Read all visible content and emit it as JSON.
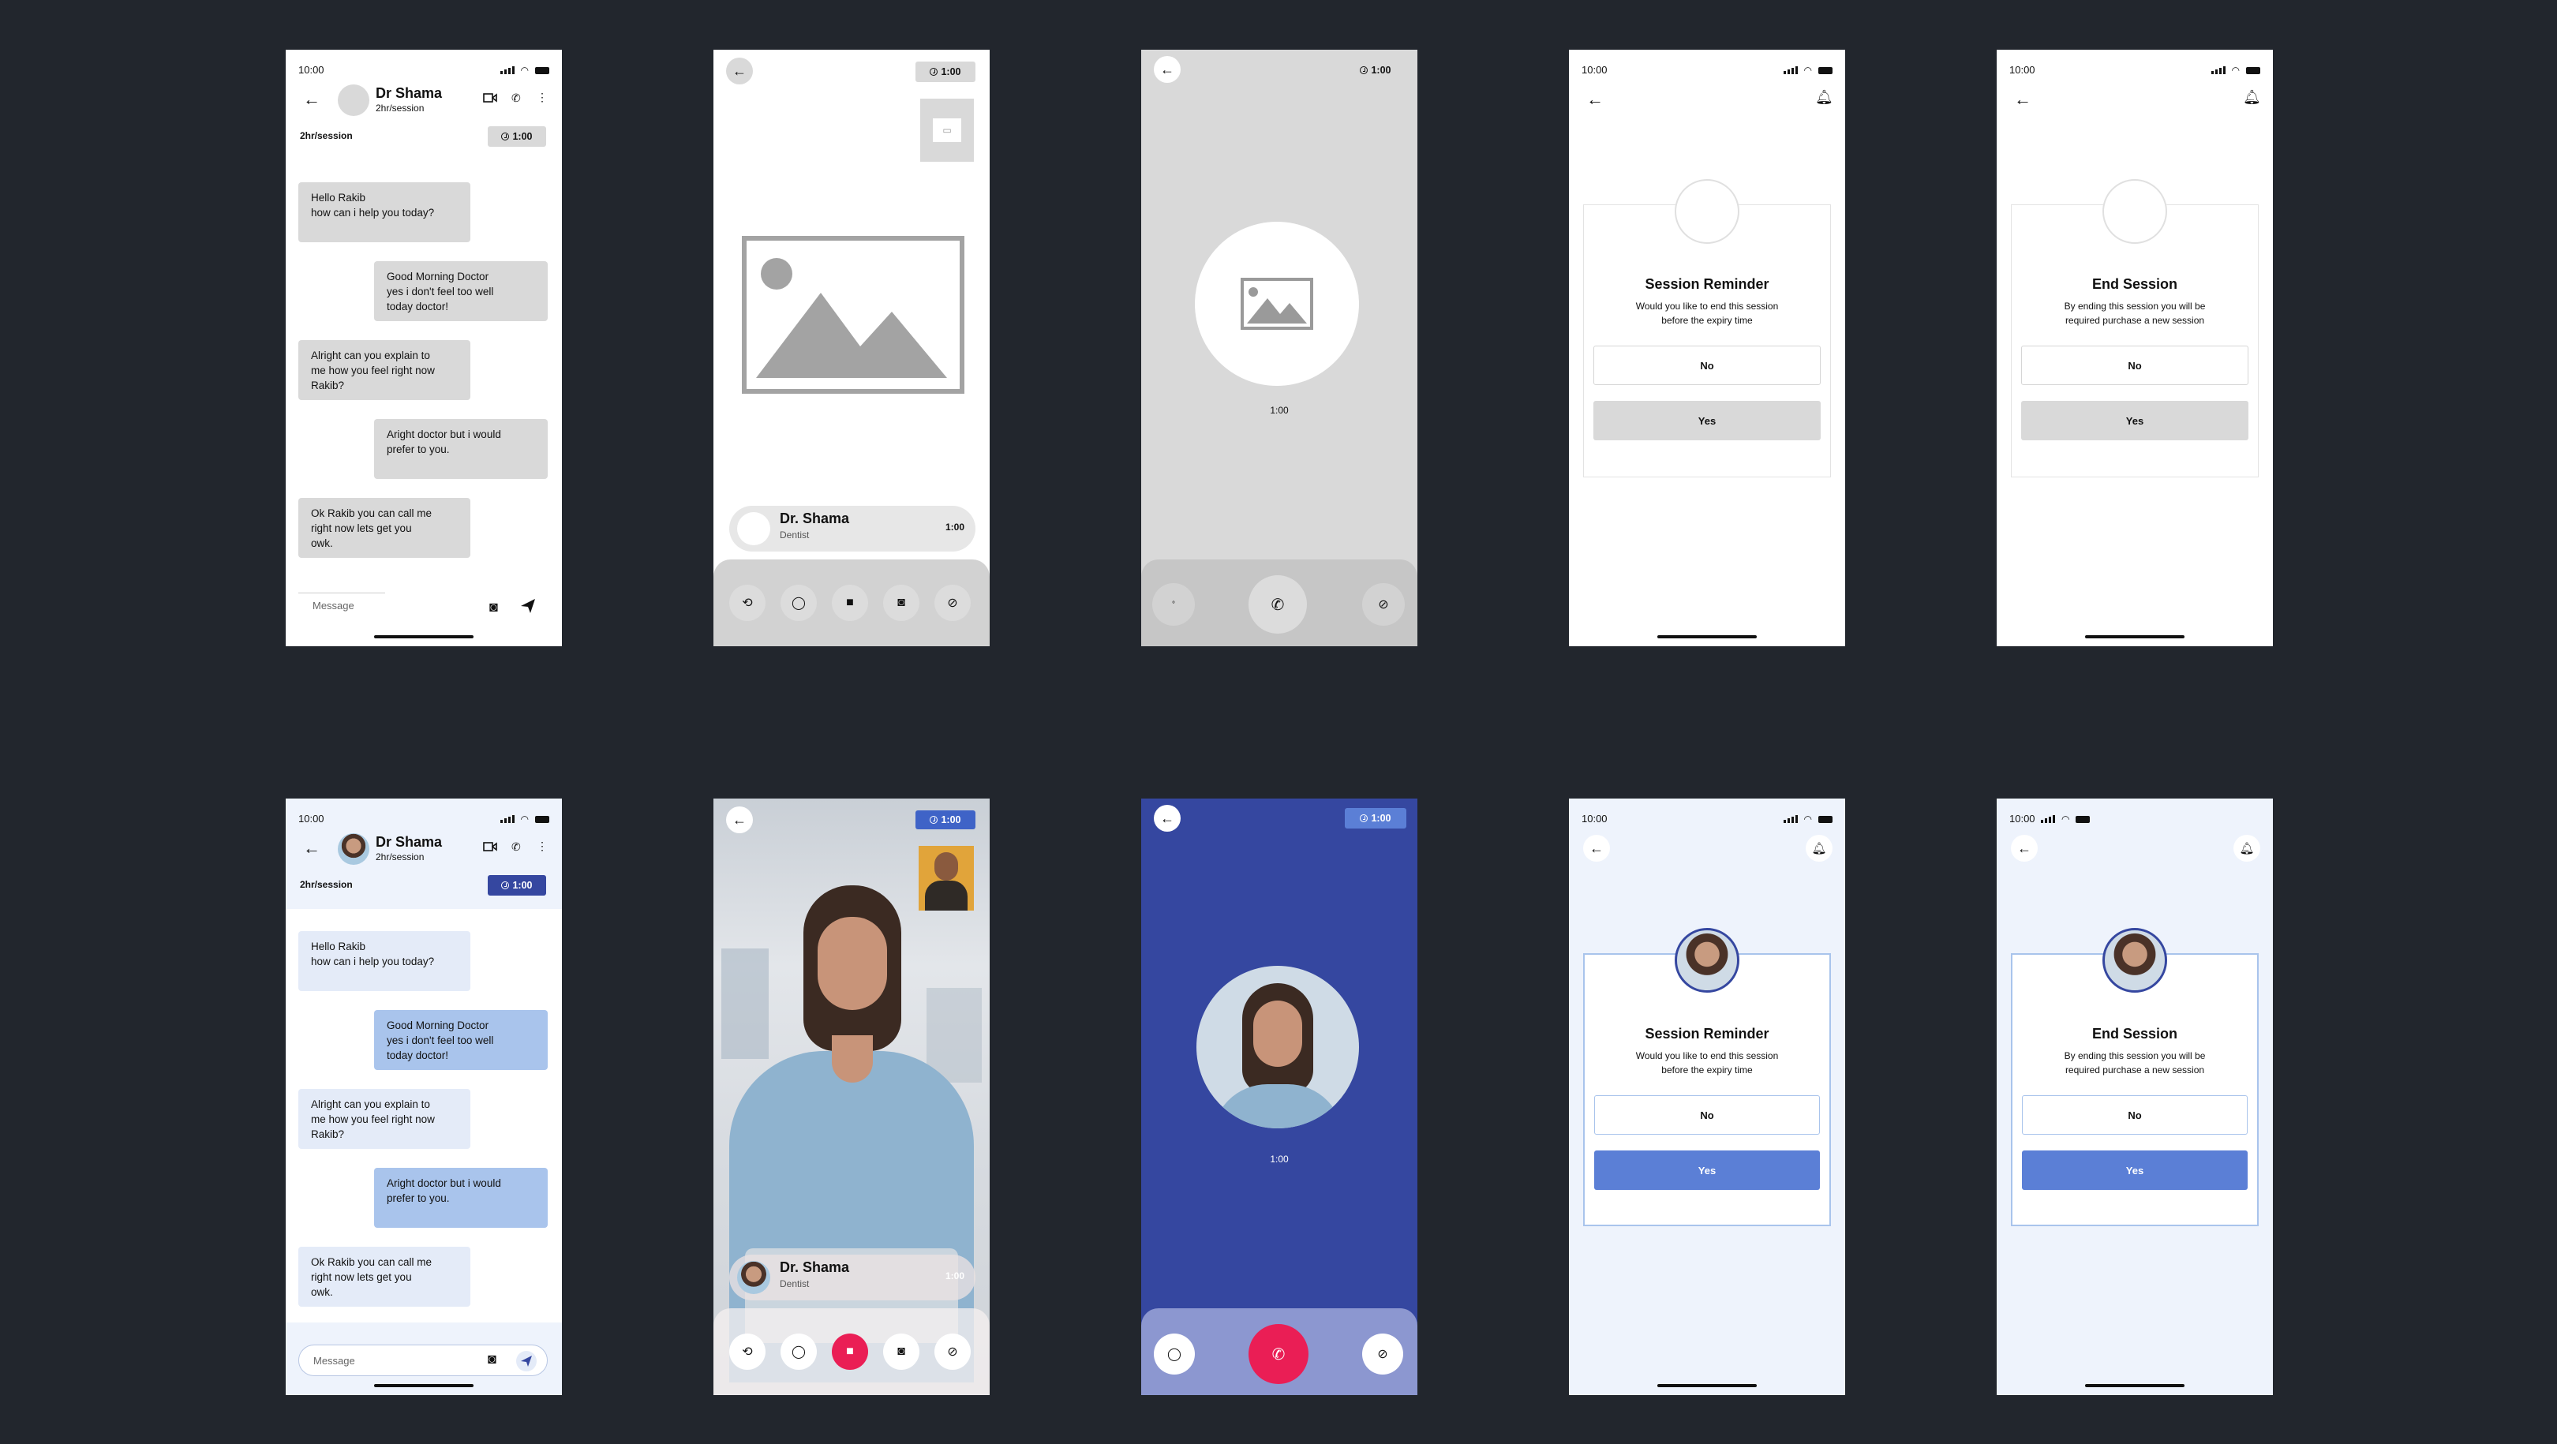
{
  "status_time": "10:00",
  "doctor": {
    "name": "Dr Shama",
    "name_alt": "Dr. Shama",
    "rate": "2hr/session",
    "specialty": "Dentist"
  },
  "timer": "1:00",
  "chat": {
    "messages": [
      {
        "side": "left",
        "text": "Hello Rakib\nhow can i help you today?"
      },
      {
        "side": "right",
        "text": "Good Morning Doctor\nyes i don't feel too well\ntoday doctor!"
      },
      {
        "side": "left",
        "text": "Alright can you explain to\nme how you feel right now\nRakib?"
      },
      {
        "side": "right",
        "text": "Aright doctor but i would\nprefer to you."
      },
      {
        "side": "left",
        "text": "Ok Rakib you can call me\nright now lets get you\nowk."
      }
    ],
    "input_placeholder": "Message"
  },
  "reminder": {
    "title": "Session Reminder",
    "body": "Would you like to end this session before the expiry time"
  },
  "end_session": {
    "title": "End Session",
    "body": "By ending this session you will be required purchase a new session"
  },
  "buttons": {
    "no": "No",
    "yes": "Yes"
  },
  "icons": [
    "back-arrow-icon",
    "video-icon",
    "phone-icon",
    "more-icon",
    "clock-icon",
    "camera-icon",
    "send-icon",
    "chat-icon",
    "mic-off-icon",
    "call-end-icon",
    "bell-icon",
    "image-placeholder-icon",
    "flip-camera-icon"
  ],
  "colors": {
    "background": "#22262d",
    "accent_blue": "#5b7fd6",
    "navy": "#3547a0",
    "end_call_red": "#ea1e55",
    "light_blue_bubble": "#a9c4ec",
    "wire_gray": "#d9d9d9"
  }
}
